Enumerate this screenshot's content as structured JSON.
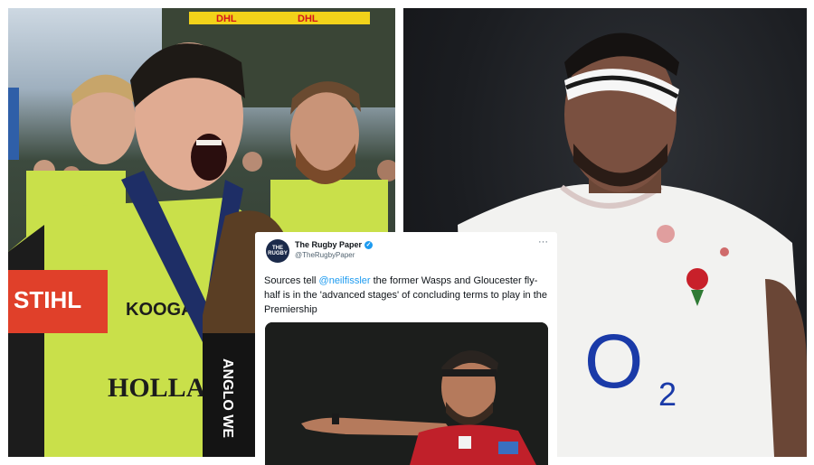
{
  "left_photo": {
    "banner_text": "DHL",
    "shirt_sponsor_text": "HOLLA",
    "sleeve_sponsor_text": "STIHL",
    "chest_brand_text": "KOOGA",
    "trophy_text": "ANGLO WE"
  },
  "right_photo": {
    "shirt_sponsor_text": "O",
    "shirt_sponsor_subscript": "2"
  },
  "tweet": {
    "avatar_text": "THE RUGBY",
    "display_name": "The Rugby Paper",
    "handle": "@TheRugbyPaper",
    "text_before": "Sources tell ",
    "mention": "@neilfissler",
    "text_after": " the former Wasps and Gloucester fly-half is in the 'advanced stages' of concluding terms to play in the Premiership"
  },
  "colors": {
    "kit_green": "#c9e04a",
    "england_white": "#f2f2f0",
    "o2_blue": "#1a3aa8",
    "twitter_blue": "#1d9bf0",
    "gloucester_red": "#c0202a"
  }
}
